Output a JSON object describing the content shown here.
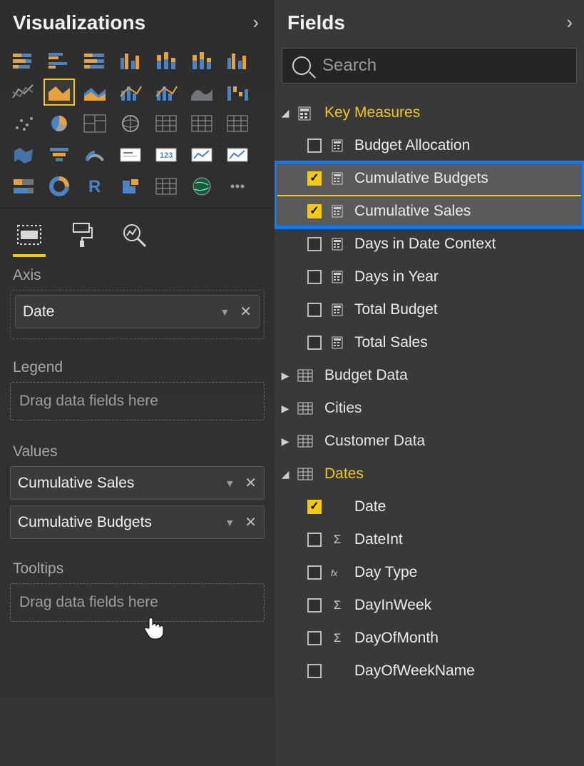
{
  "viz": {
    "title": "Visualizations",
    "icons": [
      "stacked-bar",
      "clustered-bar",
      "stacked-bar-100",
      "clustered-column",
      "stacked-column",
      "stacked-column-100",
      "clustered-column-2",
      "line",
      "area",
      "stacked-area",
      "line-clustered",
      "line-stacked",
      "ribbon",
      "waterfall",
      "scatter",
      "pie",
      "treemap",
      "donut-globe",
      "matrix",
      "table",
      "table-2",
      "filled-map",
      "funnel",
      "gauge",
      "card",
      "multi-card",
      "kpi",
      "kpi-2",
      "slicer",
      "donut",
      "r-visual",
      "shape-map",
      "table-3",
      "",
      "",
      "arcgis",
      "more",
      "",
      "",
      "",
      "",
      ""
    ],
    "selected_icon_index": 8,
    "tabs": {
      "fields": "fields-tab",
      "format": "format-tab",
      "analytics": "analytics-tab"
    },
    "sections": {
      "axis": {
        "label": "Axis",
        "items": [
          "Date"
        ]
      },
      "legend": {
        "label": "Legend",
        "placeholder": "Drag data fields here"
      },
      "values": {
        "label": "Values",
        "items": [
          "Cumulative Sales",
          "Cumulative Budgets"
        ]
      },
      "tooltips": {
        "label": "Tooltips",
        "placeholder": "Drag data fields here"
      }
    }
  },
  "fields": {
    "title": "Fields",
    "search_placeholder": "Search",
    "tree": [
      {
        "type": "group",
        "name": "Key Measures",
        "expanded": true,
        "highlight": true,
        "icon": "calc",
        "children": [
          {
            "name": "Budget Allocation",
            "checked": false,
            "kind": "measure"
          },
          {
            "name": "Cumulative Budgets",
            "checked": true,
            "kind": "measure",
            "boxed": true
          },
          {
            "name": "Cumulative Sales",
            "checked": true,
            "kind": "measure",
            "boxed": true
          },
          {
            "name": "Days in Date Context",
            "checked": false,
            "kind": "measure"
          },
          {
            "name": "Days in Year",
            "checked": false,
            "kind": "measure"
          },
          {
            "name": "Total Budget",
            "checked": false,
            "kind": "measure"
          },
          {
            "name": "Total Sales",
            "checked": false,
            "kind": "measure"
          }
        ]
      },
      {
        "type": "group",
        "name": "Budget Data",
        "expanded": false,
        "icon": "table"
      },
      {
        "type": "group",
        "name": "Cities",
        "expanded": false,
        "icon": "table"
      },
      {
        "type": "group",
        "name": "Customer Data",
        "expanded": false,
        "icon": "table"
      },
      {
        "type": "group",
        "name": "Dates",
        "expanded": true,
        "highlight": true,
        "icon": "table",
        "children": [
          {
            "name": "Date",
            "checked": true,
            "kind": "none"
          },
          {
            "name": "DateInt",
            "checked": false,
            "kind": "sigma"
          },
          {
            "name": "Day Type",
            "checked": false,
            "kind": "fx"
          },
          {
            "name": "DayInWeek",
            "checked": false,
            "kind": "sigma"
          },
          {
            "name": "DayOfMonth",
            "checked": false,
            "kind": "sigma"
          },
          {
            "name": "DayOfWeekName",
            "checked": false,
            "kind": "none"
          }
        ]
      }
    ]
  }
}
